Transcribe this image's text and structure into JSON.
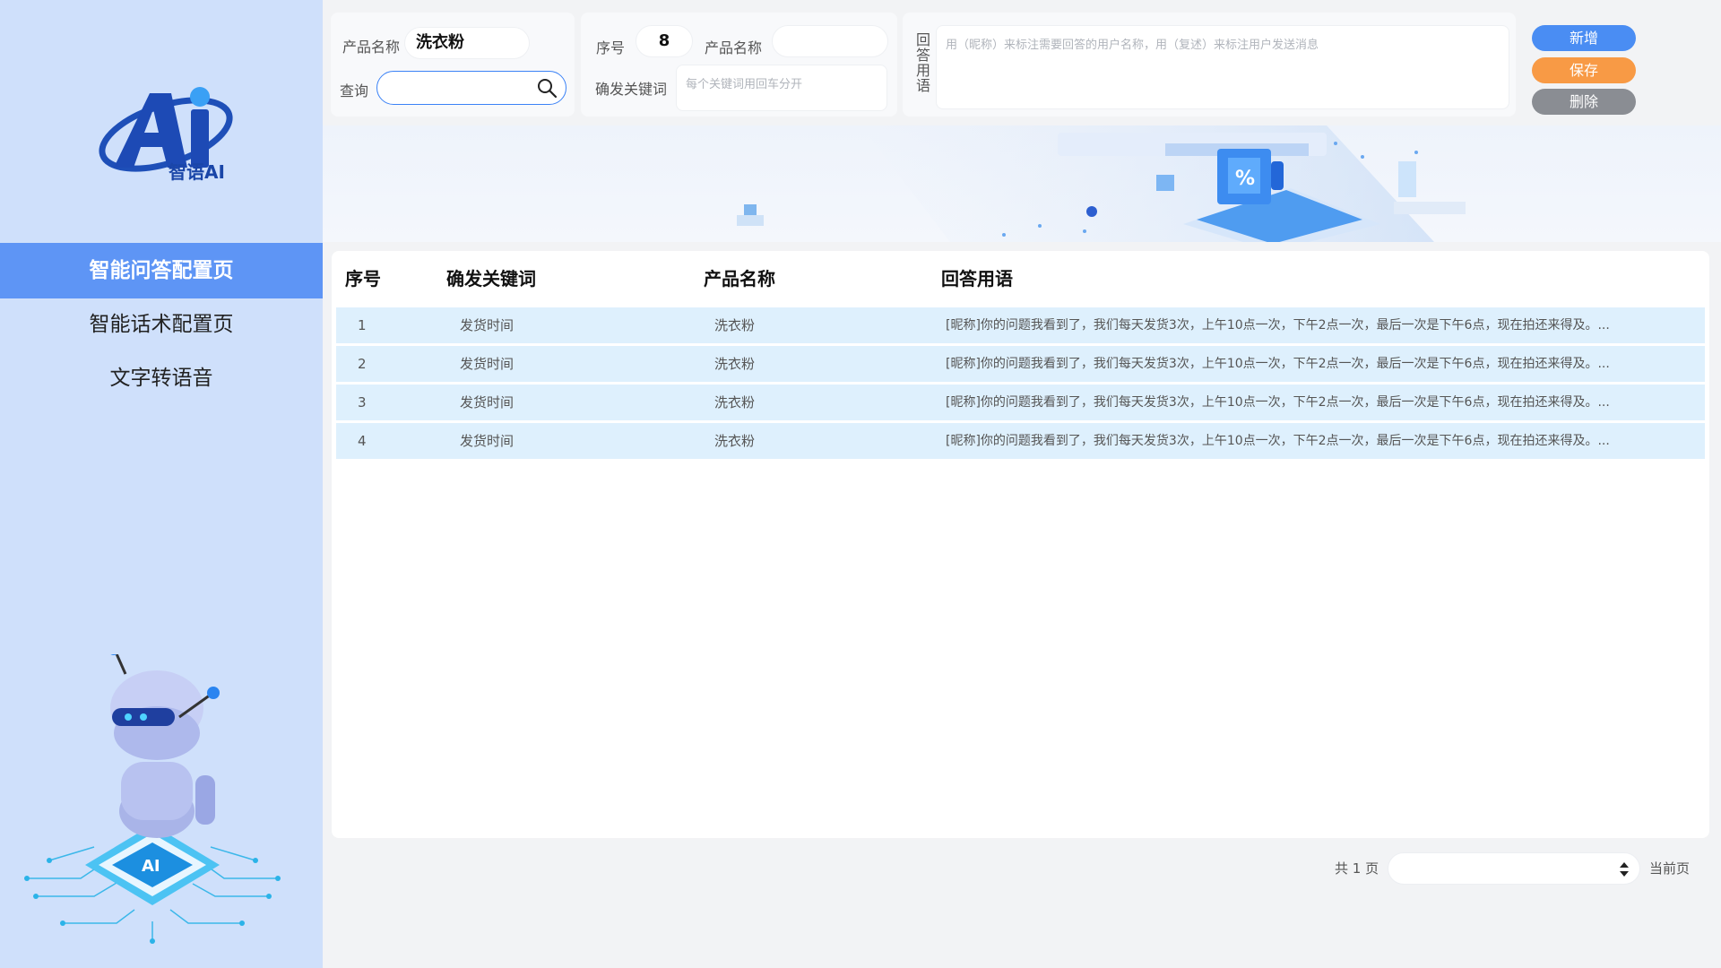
{
  "sidebar": {
    "brand": "智语AI",
    "nav": [
      {
        "label": "智能问答配置页",
        "active": true
      },
      {
        "label": "智能话术配置页",
        "active": false
      },
      {
        "label": "文字转语音",
        "active": false
      }
    ]
  },
  "form": {
    "product_label": "产品名称",
    "product_value": "洗衣粉",
    "query_label": "查询",
    "query_value": "",
    "seq_label": "序号",
    "seq_value": "8",
    "product_label_2": "产品名称",
    "product_value_2": "",
    "keyword_label": "确发关键词",
    "keyword_placeholder": "每个关键词用回车分开",
    "answer_label": "回答用语",
    "answer_placeholder": "用（昵称）来标注需要回答的用户名称，用（复述）来标注用户发送消息"
  },
  "actions": {
    "add": "新增",
    "save": "保存",
    "delete": "删除"
  },
  "table": {
    "headers": {
      "no": "序号",
      "keyword": "确发关键词",
      "product": "产品名称",
      "answer": "回答用语"
    },
    "rows": [
      {
        "no": "1",
        "keyword": "发货时间",
        "product": "洗衣粉",
        "answer": "[昵称]你的问题我看到了，我们每天发货3次，上午10点一次，下午2点一次，最后一次是下午6点，现在拍还来得及。..."
      },
      {
        "no": "2",
        "keyword": "发货时间",
        "product": "洗衣粉",
        "answer": "[昵称]你的问题我看到了，我们每天发货3次，上午10点一次，下午2点一次，最后一次是下午6点，现在拍还来得及。..."
      },
      {
        "no": "3",
        "keyword": "发货时间",
        "product": "洗衣粉",
        "answer": "[昵称]你的问题我看到了，我们每天发货3次，上午10点一次，下午2点一次，最后一次是下午6点，现在拍还来得及。..."
      },
      {
        "no": "4",
        "keyword": "发货时间",
        "product": "洗衣粉",
        "answer": "[昵称]你的问题我看到了，我们每天发货3次，上午10点一次，下午2点一次，最后一次是下午6点，现在拍还来得及。..."
      }
    ]
  },
  "pager": {
    "total": "共 1 页",
    "current_label": "当前页",
    "current_value": ""
  },
  "colors": {
    "sidebar_bg": "#cfe0fb",
    "active_nav": "#5e95f5",
    "add_button": "#4a8df3",
    "save_button": "#f89a45",
    "delete_button": "#8a8d93",
    "row_bg": "#def0fd"
  },
  "icons": {
    "logo": "ai-logo-icon",
    "search": "search-icon",
    "robot": "robot-illustration",
    "pager": "sort-arrows-icon"
  }
}
